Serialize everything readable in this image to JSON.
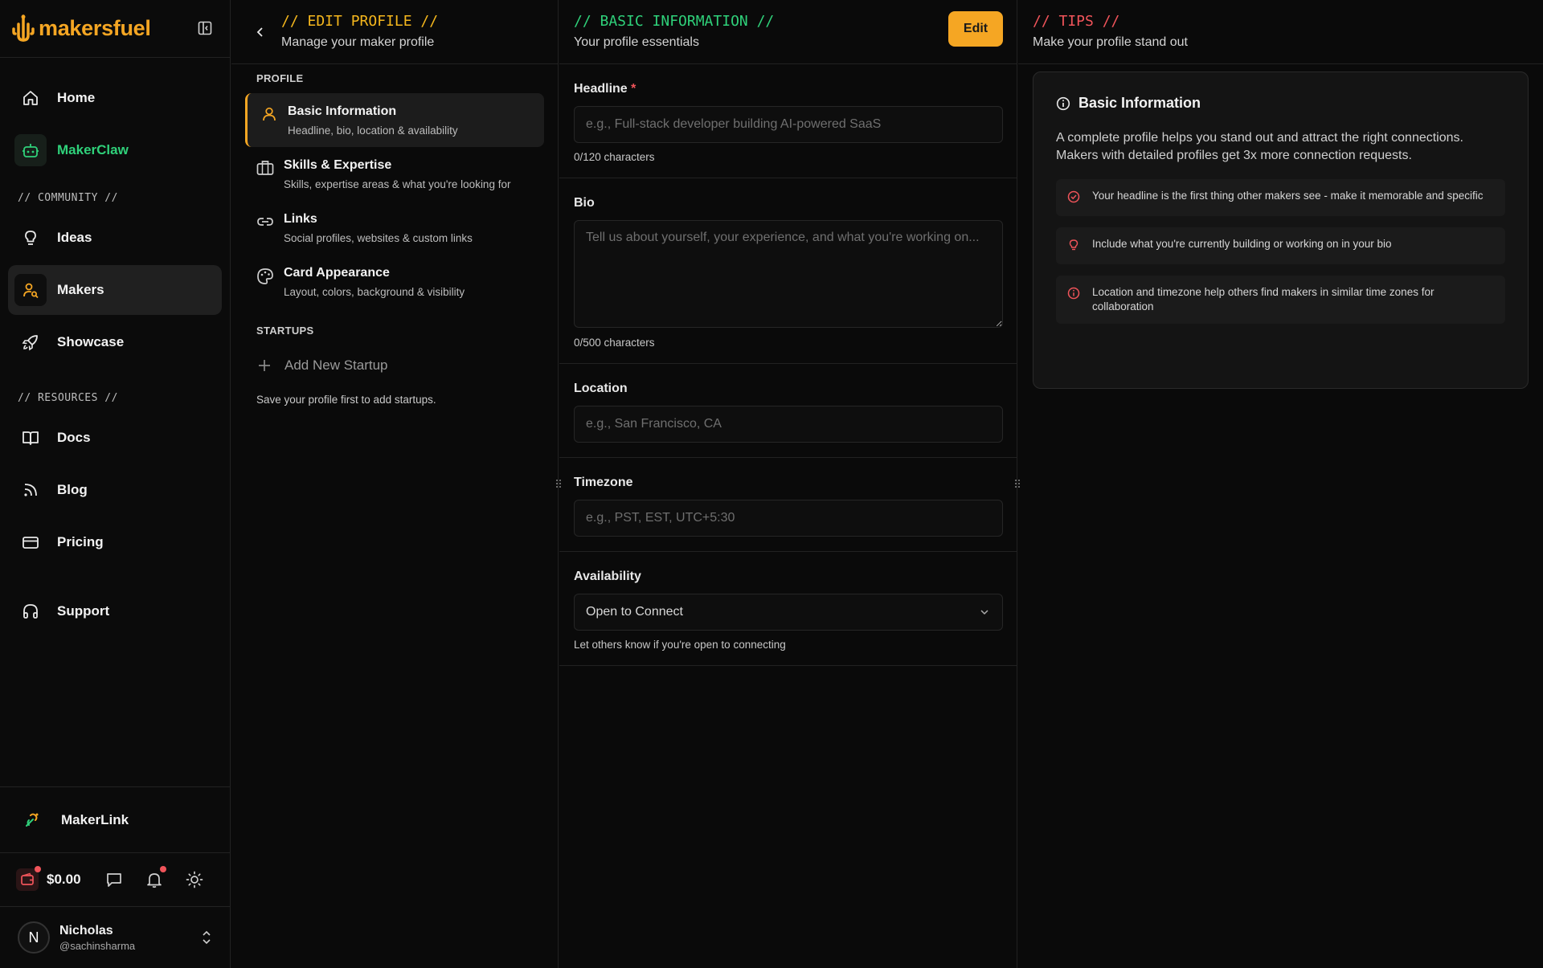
{
  "brand": {
    "name": "makersfuel",
    "accent": "#f5a623"
  },
  "sidebar": {
    "top_items": [
      {
        "label": "Home",
        "icon": "home-icon"
      },
      {
        "label": "MakerClaw",
        "icon": "robot-icon"
      }
    ],
    "community_label": "// COMMUNITY //",
    "community_items": [
      {
        "label": "Ideas",
        "icon": "lightbulb-icon"
      },
      {
        "label": "Makers",
        "icon": "users-icon"
      },
      {
        "label": "Showcase",
        "icon": "rocket-icon"
      }
    ],
    "resources_label": "// RESOURCES //",
    "resource_items": [
      {
        "label": "Docs",
        "icon": "book-icon"
      },
      {
        "label": "Blog",
        "icon": "rss-icon"
      },
      {
        "label": "Pricing",
        "icon": "credit-card-icon"
      },
      {
        "label": "Support",
        "icon": "headphones-icon"
      }
    ],
    "makerlink": "MakerLink",
    "balance": "$0.00",
    "user": {
      "initial": "N",
      "name": "Nicholas",
      "handle": "@sachinsharma"
    }
  },
  "edit_profile": {
    "title": "// EDIT PROFILE //",
    "subtitle": "Manage your maker profile",
    "profile_label": "PROFILE",
    "items": [
      {
        "title": "Basic Information",
        "desc": "Headline, bio, location & availability"
      },
      {
        "title": "Skills & Expertise",
        "desc": "Skills, expertise areas & what you're looking for"
      },
      {
        "title": "Links",
        "desc": "Social profiles, websites & custom links"
      },
      {
        "title": "Card Appearance",
        "desc": "Layout, colors, background & visibility"
      }
    ],
    "startups_label": "STARTUPS",
    "add_startup": "Add New Startup",
    "hint": "Save your profile first to add startups."
  },
  "basic_info": {
    "title": "// BASIC INFORMATION //",
    "subtitle": "Your profile essentials",
    "edit_label": "Edit",
    "headline": {
      "label": "Headline",
      "required": "*",
      "placeholder": "e.g., Full-stack developer building AI-powered SaaS",
      "count": "0/120 characters"
    },
    "bio": {
      "label": "Bio",
      "placeholder": "Tell us about yourself, your experience, and what you're working on...",
      "count": "0/500 characters"
    },
    "location": {
      "label": "Location",
      "placeholder": "e.g., San Francisco, CA"
    },
    "timezone": {
      "label": "Timezone",
      "placeholder": "e.g., PST, EST, UTC+5:30"
    },
    "availability": {
      "label": "Availability",
      "value": "Open to Connect",
      "hint": "Let others know if you're open to connecting"
    }
  },
  "tips": {
    "title": "// TIPS //",
    "subtitle": "Make your profile stand out",
    "card_title": "Basic Information",
    "intro": "A complete profile helps you stand out and attract the right connections. Makers with detailed profiles get 3x more connection requests.",
    "items": [
      "Your headline is the first thing other makers see - make it memorable and specific",
      "Include what you're currently building or working on in your bio",
      "Location and timezone help others find makers in similar time zones for collaboration"
    ]
  },
  "colors": {
    "green": "#2fd17a",
    "red": "#f0545a",
    "yellow": "#f5b71d"
  }
}
